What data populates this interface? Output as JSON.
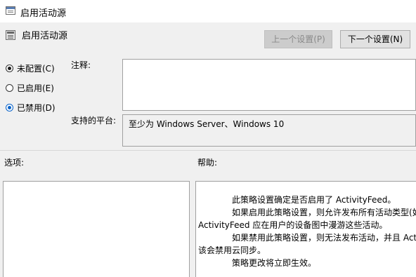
{
  "window": {
    "title": "启用活动源"
  },
  "header": {
    "title": "启用活动源"
  },
  "buttons": {
    "prev": "上一个设置(P)",
    "next": "下一个设置(N)"
  },
  "radios": [
    {
      "label": "未配置(C)",
      "checked": true
    },
    {
      "label": "已启用(E)",
      "checked": false
    },
    {
      "label": "已禁用(D)",
      "checked": true
    }
  ],
  "comment": {
    "label": "注释:",
    "value": ""
  },
  "platform": {
    "label": "支持的平台:",
    "value": "至少为 Windows Server、Windows 10"
  },
  "options": {
    "label": "选项:"
  },
  "help": {
    "label": "帮助:",
    "lines": [
      "此策略设置确定是否启用了 ActivityFeed。",
      "如果启用此策略设置，则允许发布所有活动类型(如",
      "ActivityFeed 应在用户的设备图中漫游这些活动。",
      "如果禁用此策略设置，则无法发布活动，并且 Act",
      "该会禁用云同步。",
      "策略更改将立即生效。"
    ]
  },
  "colors": {
    "accent": "#0a63c9",
    "background": "#f0f0f0"
  }
}
